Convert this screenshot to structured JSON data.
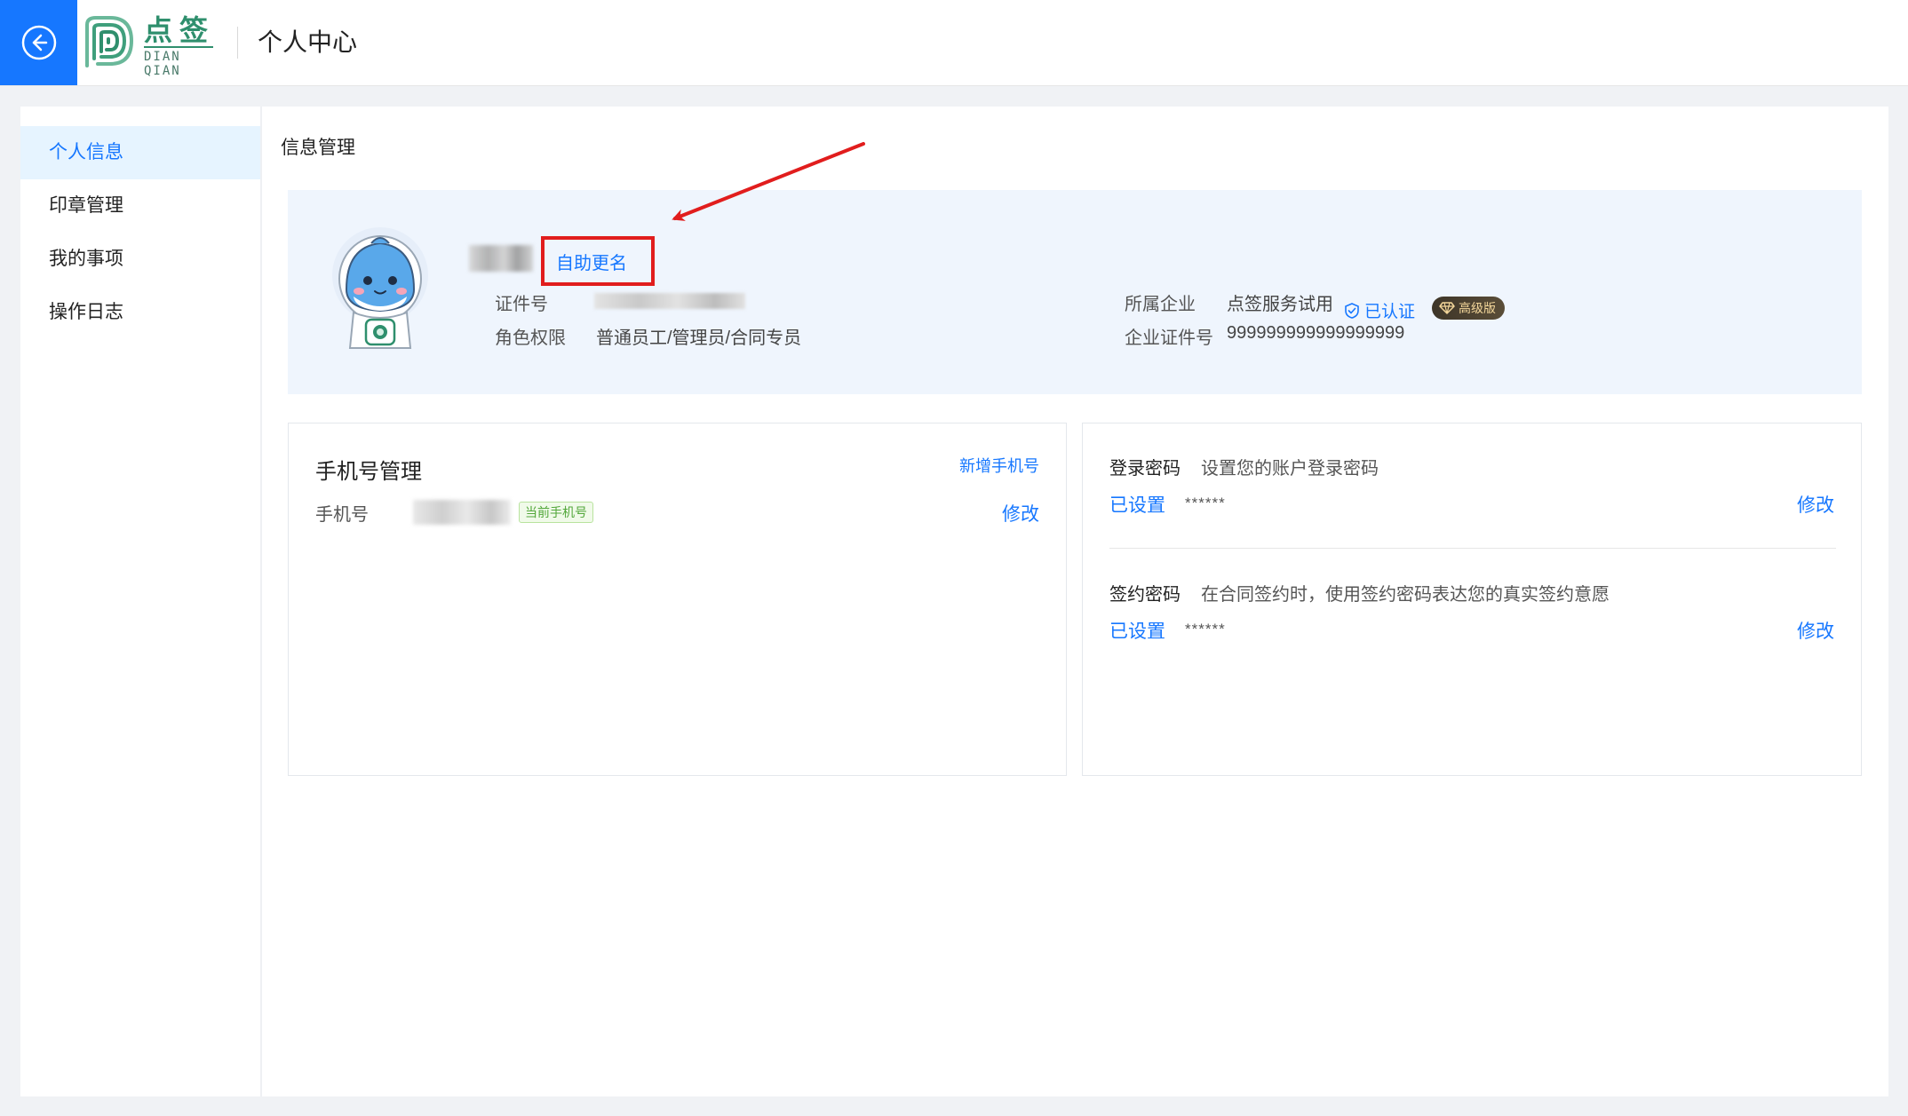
{
  "header": {
    "logo_cn": "点签",
    "logo_en": "DIAN QIAN",
    "title": "个人中心"
  },
  "sidebar": {
    "items": [
      {
        "label": "个人信息",
        "active": true
      },
      {
        "label": "印章管理"
      },
      {
        "label": "我的事项"
      },
      {
        "label": "操作日志"
      }
    ]
  },
  "content": {
    "title": "信息管理"
  },
  "profile": {
    "rename_label": "自助更名",
    "id_label": "证件号",
    "role_label": "角色权限",
    "role_value": "普通员工/管理员/合同专员",
    "company_label": "所属企业",
    "company_value": "点签服务试用",
    "verified_label": "已认证",
    "premium_label": "高级版",
    "company_id_label": "企业证件号",
    "company_id_value": "999999999999999999"
  },
  "phone": {
    "title": "手机号管理",
    "add_label": "新增手机号",
    "phone_label": "手机号",
    "current_tag": "当前手机号",
    "edit_label": "修改"
  },
  "passwords": {
    "login": {
      "title": "登录密码",
      "desc": "设置您的账户登录密码",
      "status": "已设置",
      "mask": "******",
      "edit_label": "修改"
    },
    "sign": {
      "title": "签约密码",
      "desc": "在合同签约时，使用签约密码表达您的真实签约意愿",
      "status": "已设置",
      "mask": "******",
      "edit_label": "修改"
    }
  },
  "colors": {
    "accent": "#1677ff",
    "annotation": "#e11d1d",
    "brand_green": "#2f8f6d"
  }
}
